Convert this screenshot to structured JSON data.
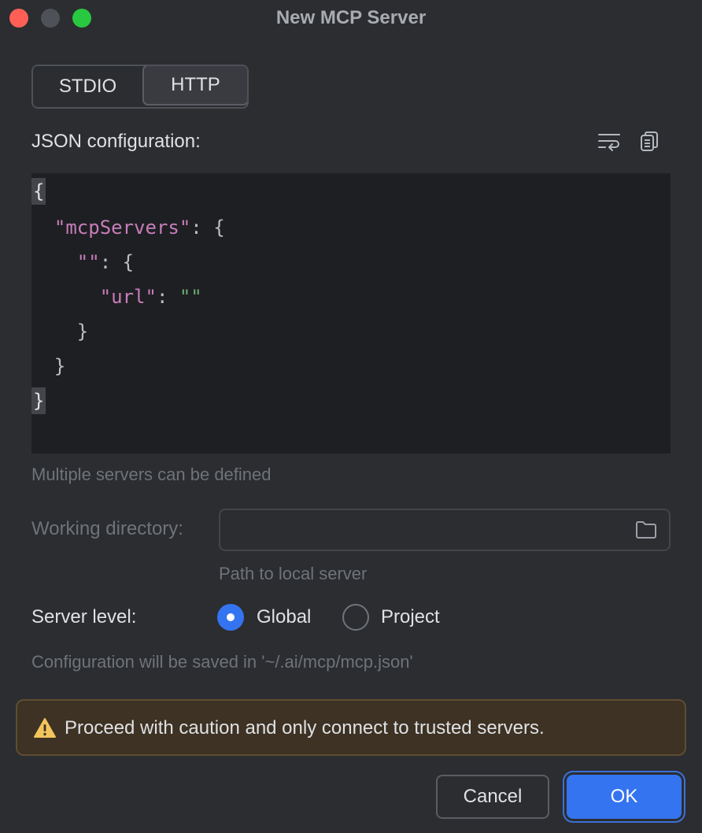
{
  "window": {
    "title": "New MCP Server"
  },
  "transport_tabs": {
    "stdio": "STDIO",
    "http": "HTTP",
    "selected": "HTTP"
  },
  "json_config": {
    "label": "JSON configuration:",
    "wrap_icon": "soft-wrap-icon",
    "copy_icon": "copy-icon",
    "lines": {
      "l1": "{",
      "l2_key": "\"mcpServers\"",
      "l2_rest": ": {",
      "l3_key": "\"\"",
      "l3_rest": ": {",
      "l4_key": "\"url\"",
      "l4_colon": ": ",
      "l4_val": "\"\"",
      "l5": "}",
      "l6": "}",
      "l7": "}"
    },
    "hint": "Multiple servers can be defined"
  },
  "working_directory": {
    "label": "Working directory:",
    "value": "",
    "hint": "Path to local server",
    "browse_icon": "folder-icon"
  },
  "server_level": {
    "label": "Server level:",
    "options": {
      "global": "Global",
      "project": "Project"
    },
    "selected": "Global",
    "hint": "Configuration will be saved in '~/.ai/mcp/mcp.json'"
  },
  "warning": {
    "icon": "warning-icon",
    "text": "Proceed with caution and only connect to trusted servers."
  },
  "buttons": {
    "cancel": "Cancel",
    "ok": "OK"
  },
  "colors": {
    "accent": "#3574f0",
    "json_key": "#c77dbb",
    "json_string": "#6aab73",
    "warning_bg": "#3d3223",
    "warning_icon": "#f2c55c"
  }
}
